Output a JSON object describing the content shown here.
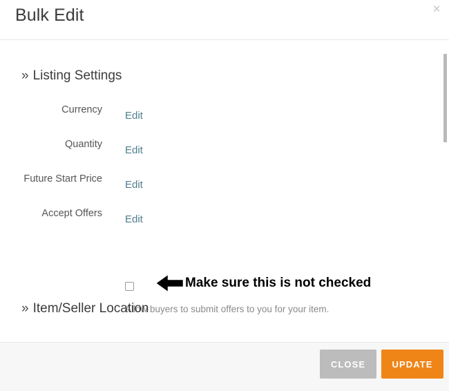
{
  "header": {
    "title": "Bulk Edit",
    "close_icon": "close-icon",
    "close_glyph": "✕"
  },
  "body": {
    "sections": [
      {
        "chevron": "»",
        "label": "Listing Settings"
      },
      {
        "chevron": "»",
        "label": "Item/Seller Location"
      }
    ],
    "fields": [
      {
        "label": "Currency",
        "action": "Edit"
      },
      {
        "label": "Quantity",
        "action": "Edit"
      },
      {
        "label": "Future Start Price",
        "action": "Edit"
      },
      {
        "label": "Accept Offers",
        "action": "Edit"
      }
    ],
    "accept_offers": {
      "checked": false,
      "annotation_arrow_icon": "left-arrow-icon",
      "annotation_text": "Make sure this is not checked",
      "help_text": "Allow buyers to submit offers to you for your item."
    },
    "scrollbar": {
      "name": "vertical-scrollbar"
    }
  },
  "footer": {
    "close_label": "CLOSE",
    "update_label": "UPDATE"
  },
  "colors": {
    "accent_orange": "#ef8517",
    "button_gray": "#bcbcbc",
    "link_blue": "#4f7d8e",
    "text_dark": "#3b3b3b",
    "text_muted": "#8a8a8a",
    "footer_bg": "#f7f7f7"
  }
}
